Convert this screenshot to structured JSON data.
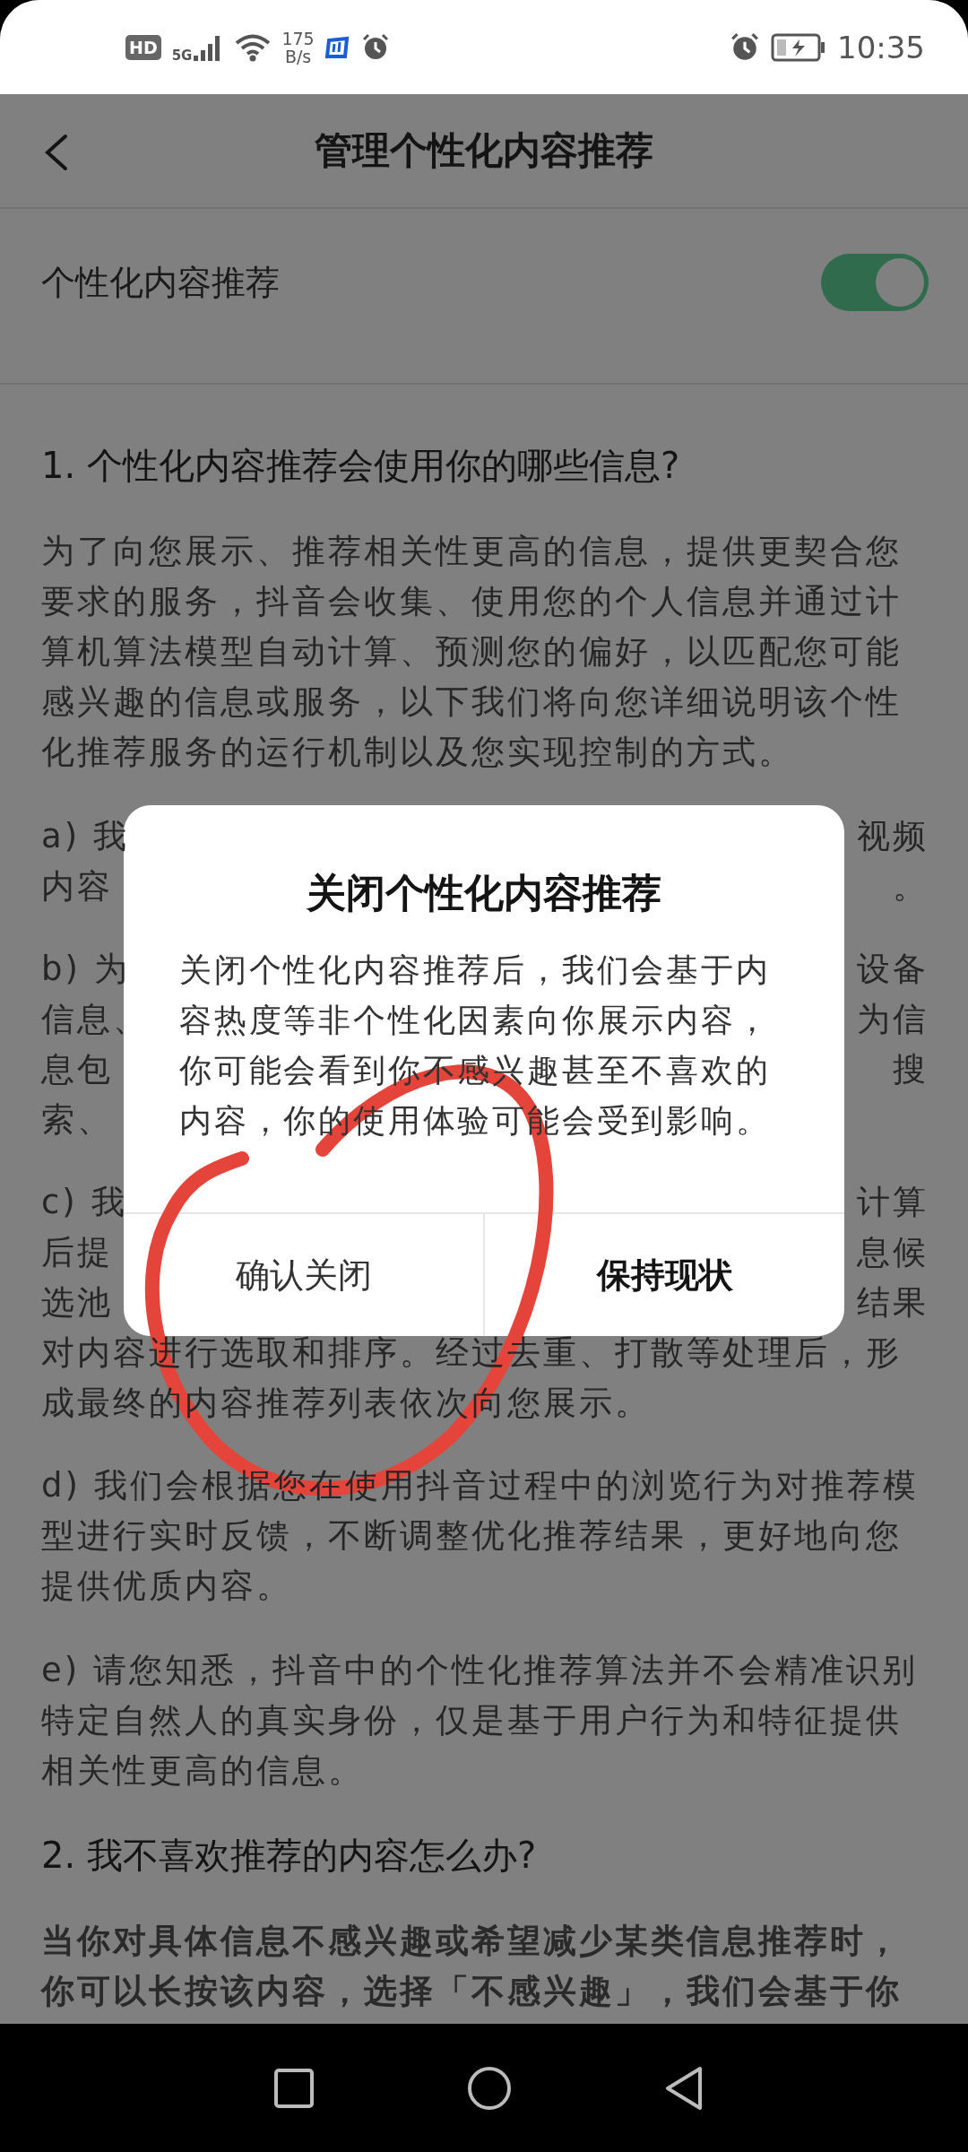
{
  "status_bar": {
    "hd": "HD",
    "network": "5G",
    "speed": "175",
    "speed_unit": "B/s",
    "time": "10:35"
  },
  "header": {
    "title": "管理个性化内容推荐"
  },
  "setting": {
    "label": "个性化内容推荐",
    "on": true
  },
  "content": [
    {
      "kind": "heading",
      "text": "1. 个性化内容推荐会使用你的哪些信息?"
    },
    {
      "kind": "paragraph",
      "text": "为了向您展示、推荐相关性更高的信息，提供更契合您要求的服务，抖音会收集、使用您的个人信息并通过计算机算法模型自动计算、预测您的偏好，以匹配您可能感兴趣的信息或服务，以下我们将向您详细说明该个性化推荐服务的运行机制以及您实现控制的方式。"
    },
    {
      "kind": "covered",
      "lines": [
        {
          "left": "a) 我",
          "right": "视频"
        },
        {
          "left": "内容",
          "right": "。"
        }
      ]
    },
    {
      "kind": "covered",
      "lines": [
        {
          "left": "b) 为",
          "right": "设备"
        },
        {
          "left": "信息、",
          "right": "为信"
        },
        {
          "left": "息包",
          "right": "搜"
        },
        {
          "left": "索、"
        }
      ]
    },
    {
      "kind": "covered",
      "lines": [
        {
          "left": "c) 我",
          "right": "计算"
        },
        {
          "left": "后提",
          "right": "息候"
        },
        {
          "left": "选池",
          "right": "结果"
        }
      ],
      "tail": "对内容进行选取和排序。经过去重、打散等处理后，形成最终的内容推荐列表依次向您展示。"
    },
    {
      "kind": "paragraph",
      "text": "d) 我们会根据您在使用抖音过程中的浏览行为对推荐模型进行实时反馈，不断调整优化推荐结果，更好地向您提供优质内容。"
    },
    {
      "kind": "paragraph",
      "text": "e) 请您知悉，抖音中的个性化推荐算法并不会精准识别特定自然人的真实身份，仅是基于用户行为和特征提供相关性更高的信息。"
    },
    {
      "kind": "heading",
      "text": "2. 我不喜欢推荐的内容怎么办?"
    },
    {
      "kind": "bold_paragraph",
      "text": "当你对具体信息不感兴趣或希望减少某类信息推荐时，你可以长按该内容，选择「不感兴趣」，我们会基于你"
    }
  ],
  "dialog": {
    "title": "关闭个性化内容推荐",
    "message": "关闭个性化内容推荐后，我们会基于内容热度等非个性化因素向你展示内容，你可能会看到你不感兴趣甚至不喜欢的内容，你的使用体验可能会受到影响。",
    "buttons": [
      {
        "label": "确认关闭",
        "kind": "secondary"
      },
      {
        "label": "保持现状",
        "kind": "primary"
      }
    ]
  }
}
